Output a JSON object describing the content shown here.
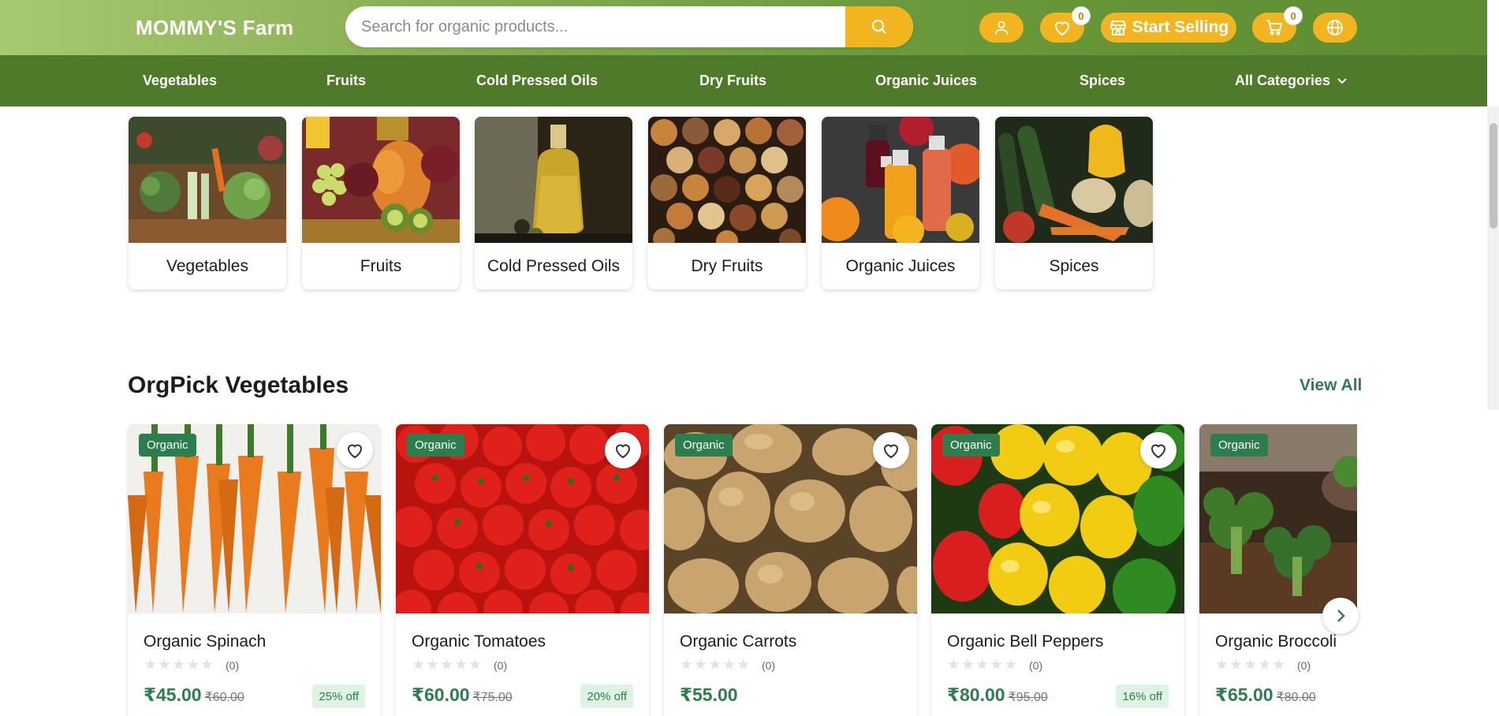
{
  "header": {
    "brand": "MOMMY'S Farm",
    "search_placeholder": "Search for organic products...",
    "wishlist_count": "0",
    "start_selling_label": "Start Selling",
    "cart_count": "0",
    "accent_color": "#f2b51f"
  },
  "nav": {
    "items": [
      "Vegetables",
      "Fruits",
      "Cold Pressed Oils",
      "Dry Fruits",
      "Organic Juices",
      "Spices",
      "All Categories"
    ]
  },
  "categories": [
    {
      "label": "Vegetables"
    },
    {
      "label": "Fruits"
    },
    {
      "label": "Cold Pressed Oils"
    },
    {
      "label": "Dry Fruits"
    },
    {
      "label": "Organic Juices"
    },
    {
      "label": "Spices"
    }
  ],
  "section": {
    "title": "OrgPick Vegetables",
    "view_all": "View All"
  },
  "products": [
    {
      "tag": "Organic",
      "name": "Organic Spinach",
      "reviews": "(0)",
      "price": "₹45.00",
      "mrp": "₹60.00",
      "discount": "25% off",
      "rating": 0
    },
    {
      "tag": "Organic",
      "name": "Organic Tomatoes",
      "reviews": "(0)",
      "price": "₹60.00",
      "mrp": "₹75.00",
      "discount": "20% off",
      "rating": 0
    },
    {
      "tag": "Organic",
      "name": "Organic Carrots",
      "reviews": "(0)",
      "price": "₹55.00",
      "mrp": "",
      "discount": "",
      "rating": 0
    },
    {
      "tag": "Organic",
      "name": "Organic Bell Peppers",
      "reviews": "(0)",
      "price": "₹80.00",
      "mrp": "₹95.00",
      "discount": "16% off",
      "rating": 0
    },
    {
      "tag": "Organic",
      "name": "Organic Broccoli",
      "reviews": "(0)",
      "price": "₹65.00",
      "mrp": "₹80.00",
      "discount": "",
      "rating": 0
    }
  ]
}
